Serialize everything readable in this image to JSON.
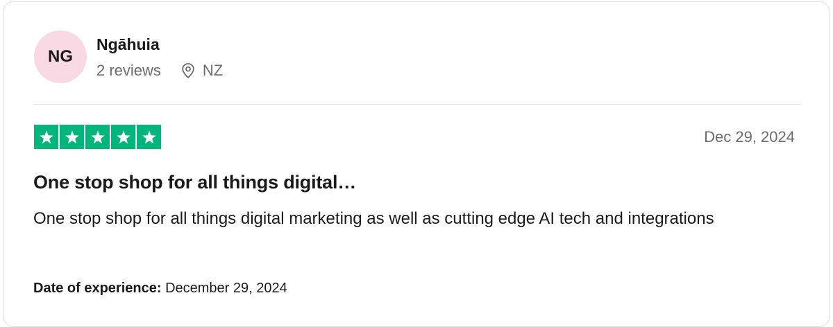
{
  "reviewer": {
    "initials": "NG",
    "name": "Ngāhuia",
    "reviews_count": "2 reviews",
    "location": "NZ",
    "location_icon": "location-pin-icon",
    "avatar_color": "#f8d9e4"
  },
  "review": {
    "rating": 5,
    "rating_max": 5,
    "star_color": "#00b67a",
    "date": "Dec 29, 2024",
    "title": "One stop shop for all things digital…",
    "body": "One stop shop for all things digital marketing as well as cutting edge AI tech and integrations",
    "experience_label": "Date of experience:",
    "experience_date": "December 29, 2024"
  }
}
